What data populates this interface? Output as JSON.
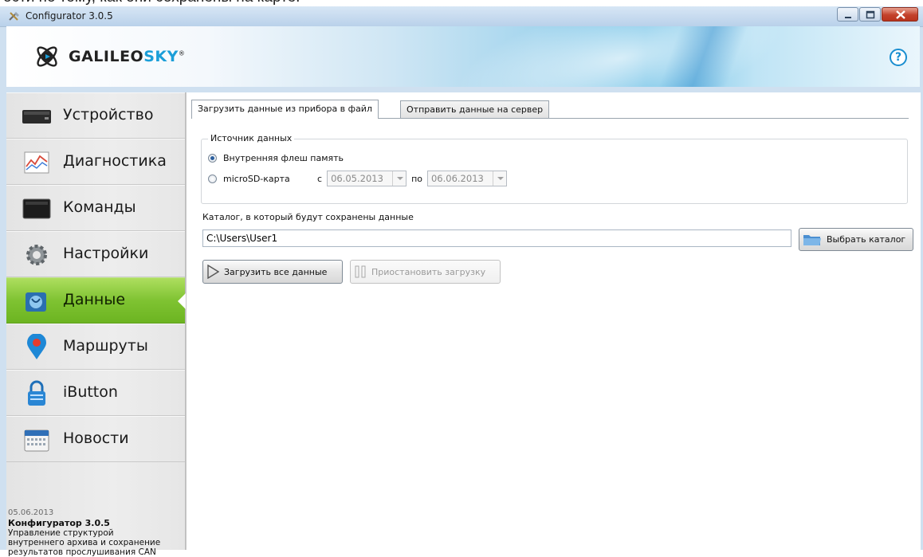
{
  "top_cut_text": "ости по тому, как они сохранены на карте.",
  "window": {
    "title": "Configurator 3.0.5"
  },
  "header": {
    "logo_main": "GALILEO",
    "logo_accent": "SKY",
    "logo_mark": "®",
    "help": "?"
  },
  "sidebar": {
    "items": [
      {
        "label": "Устройство",
        "icon": "device-icon"
      },
      {
        "label": "Диагностика",
        "icon": "diagnostics-chart-icon"
      },
      {
        "label": "Команды",
        "icon": "terminal-icon"
      },
      {
        "label": "Настройки",
        "icon": "gear-icon"
      },
      {
        "label": "Данные",
        "icon": "data-icon",
        "active": true
      },
      {
        "label": "Маршруты",
        "icon": "map-pin-icon"
      },
      {
        "label": "iButton",
        "icon": "lock-icon"
      },
      {
        "label": "Новости",
        "icon": "calendar-icon"
      }
    ],
    "news": {
      "date": "05.06.2013",
      "title": "Конфигуратор 3.0.5",
      "body": "Управление структурой внутреннего архива и сохранение результатов прослушивания CAN"
    }
  },
  "tabs": [
    {
      "label": "Загрузить данные из прибора в файл",
      "active": true
    },
    {
      "label": "Отправить данные на сервер",
      "active": false
    }
  ],
  "source": {
    "legend": "Источник данных",
    "option_flash": "Внутренняя флеш память",
    "option_sd": "microSD-карта",
    "selected": "option_flash",
    "from_label": "с",
    "from_date": "06.05.2013",
    "to_label": "по",
    "to_date": "06.06.2013"
  },
  "catalog": {
    "label": "Каталог, в который будут сохранены данные",
    "path": "C:\\Users\\User1",
    "choose_button": "Выбрать каталог"
  },
  "actions": {
    "load_all": "Загрузить все данные",
    "pause": "Приостановить загрузку"
  },
  "colors": {
    "active_nav": "#7fc332",
    "accent_blue": "#1a9ed8"
  }
}
